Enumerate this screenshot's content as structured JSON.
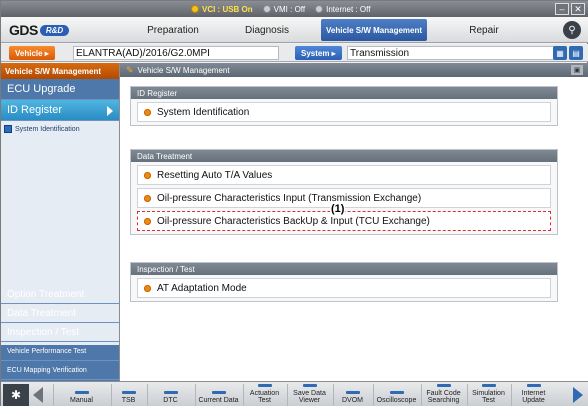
{
  "status_bar": {
    "items": [
      {
        "label": "VCI : USB On",
        "state": "on"
      },
      {
        "label": "VMI : Off",
        "state": "off"
      },
      {
        "label": "Internet : Off",
        "state": "off"
      }
    ],
    "window_buttons": [
      "–",
      "✕"
    ]
  },
  "nav": {
    "logo_gds": "GDS",
    "logo_rd": "R&D",
    "tabs": [
      "Preparation",
      "Diagnosis",
      "Vehicle S/W Management",
      "Repair"
    ],
    "active_tab_index": 2
  },
  "vehicle_bar": {
    "vehicle_button": "Vehicle ▸",
    "vehicle_name": "ELANTRA(AD)/2016/G2.0MPI",
    "system_button": "System ▸",
    "system_name": "Transmission"
  },
  "sidebar": {
    "header": "Vehicle S/W Management",
    "items": [
      {
        "label": "ECU Upgrade",
        "active": false
      },
      {
        "label": "ID Register",
        "active": true
      }
    ],
    "sub_items": [
      "System Identification"
    ],
    "bottom_items": [
      {
        "label": "Option Treatment"
      },
      {
        "label": "Data Treatment"
      },
      {
        "label": "Inspection / Test"
      },
      {
        "label": "Vehicle Performance Test"
      },
      {
        "label": "ECU Mapping Verification"
      }
    ]
  },
  "main": {
    "header": "Vehicle S/W Management",
    "panels": [
      {
        "title": "ID Register",
        "items": [
          "System Identification"
        ]
      },
      {
        "title": "Data Treatment",
        "items": [
          "Resetting Auto T/A Values",
          "Oil-pressure Characteristics Input (Transmission Exchange)",
          "Oil-pressure Characteristics BackUp & Input (TCU Exchange)"
        ]
      },
      {
        "title": "Inspection / Test",
        "items": [
          "AT Adaptation Mode"
        ]
      }
    ],
    "callout": "(1)"
  },
  "toolbar": {
    "buttons": [
      "Manual",
      "TSB",
      "DTC",
      "Current Data",
      "Actuation Test",
      "Save Data Viewer",
      "DVOM",
      "Oscilloscope",
      "Fault Code Searching",
      "Simulation Test",
      "Internet Update"
    ]
  },
  "colors": {
    "accent_orange": "#d86b11",
    "sidebar_blue": "#4e78a9",
    "active_blue": "#2c58a0",
    "highlight_red": "#e02b2b"
  }
}
